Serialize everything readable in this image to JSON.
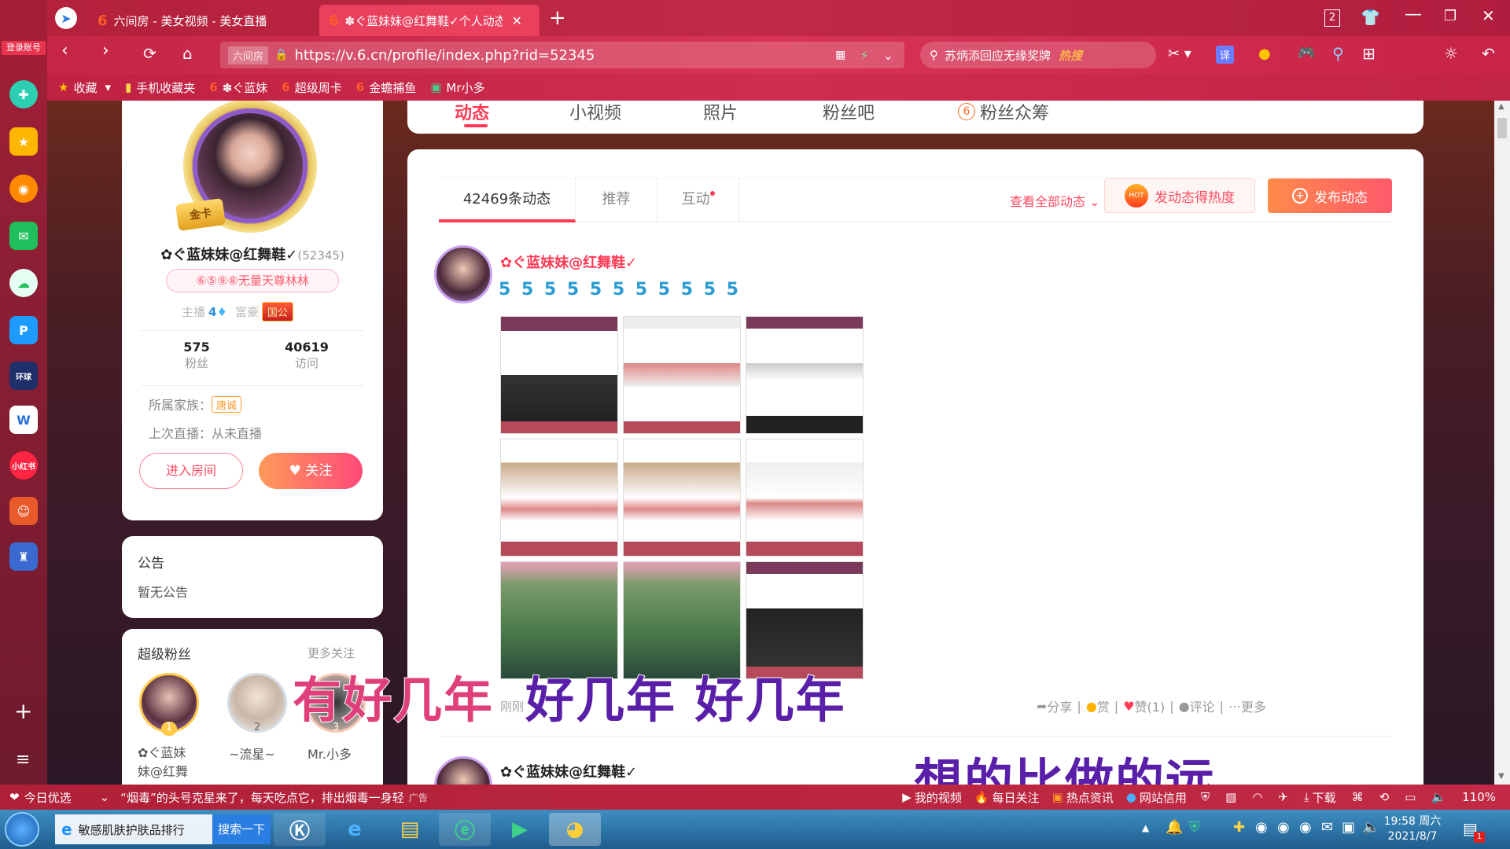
{
  "browser": {
    "tabs": [
      {
        "label": "六间房 - 美女视频 - 美女直播",
        "icon": "6"
      },
      {
        "label": "✽ぐ蓝妹妹@红舞鞋✓个人动态",
        "icon": "6"
      }
    ],
    "tab_count": "2",
    "url": "https://v.6.cn/profile/index.php?rid=52345",
    "site_tag": "六间房",
    "search_text": "苏炳添回应无缘奖牌",
    "search_badge": "热搜",
    "bookmarks": [
      "收藏",
      "手机收藏夹",
      "✽ぐ蓝妹",
      "超级周卡",
      "金蟾捕鱼",
      "Mr小多"
    ],
    "login_label": "登录账号",
    "translate_label": "译"
  },
  "profile_nav": {
    "tabs": [
      "动态",
      "小视频",
      "照片",
      "粉丝吧",
      "粉丝众筹"
    ]
  },
  "profile": {
    "name": "✿ぐ蓝妹妹@红舞鞋✓",
    "rid": "(52345)",
    "honor": "⑥⑤⑨⑧无量天尊林林",
    "host_label": "主播",
    "host_level": "4",
    "rich_label": "富豪",
    "rich_badge": "国公",
    "gold_card": "金卡",
    "fans_count": "575",
    "fans_label": "粉丝",
    "visit_count": "40619",
    "visit_label": "访问",
    "family_label": "所属家族：",
    "family_name": "唐诚",
    "last_live": "上次直播：从未直播",
    "enter_room": "进入房间",
    "follow": "关注"
  },
  "notice": {
    "title": "公告",
    "text": "暂无公告"
  },
  "super_fans": {
    "title": "超级粉丝",
    "more": "更多关注",
    "fans": [
      {
        "rank": "1",
        "name": "✿ぐ蓝妹\n妹@红舞"
      },
      {
        "rank": "2",
        "name": "~流星~"
      },
      {
        "rank": "3",
        "name": "Mr.小多"
      }
    ]
  },
  "feed": {
    "tabs": [
      "42469条动态",
      "推荐",
      "互动"
    ],
    "view_all": "查看全部动态",
    "hot_button": "发动态得热度",
    "hot_badge": "HOT",
    "publish_button": "发布动态",
    "post": {
      "author": "✿ぐ蓝妹妹@红舞鞋✓",
      "emoji_line": "5 5 5 5 5 5 5 5 5 5 5",
      "time": "刚刚",
      "actions": [
        "分享",
        "赏",
        "赞(1)",
        "评论",
        "更多"
      ]
    },
    "post2_author": "✿ぐ蓝妹妹@红舞鞋✓"
  },
  "subtitles": {
    "line1a": "有好几年",
    "line1b": "好几年  好几年",
    "line2": "想的比做的远"
  },
  "statusbar": {
    "left": "今日优选",
    "news": "“烟毒”的头号克星来了，每天吃点它，排出烟毒一身轻",
    "ad": "广告",
    "items": [
      "我的视频",
      "每日关注",
      "热点资讯",
      "网站信用",
      "下载"
    ],
    "zoom": "110%"
  },
  "taskbar": {
    "search_item": "敏感肌肤护肤品排行",
    "search_btn": "搜索一下",
    "time": "19:58 周六",
    "date": "2021/8/7",
    "notif_count": "1"
  }
}
